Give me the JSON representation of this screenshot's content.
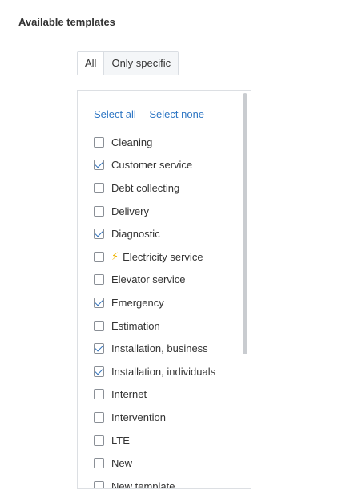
{
  "section": {
    "title": "Available templates"
  },
  "toggle": {
    "all_label": "All",
    "specific_label": "Only specific",
    "selected": "Only specific"
  },
  "actions": {
    "select_all": "Select all",
    "select_none": "Select none"
  },
  "templates": [
    {
      "label": "Cleaning",
      "checked": false
    },
    {
      "label": "Customer service",
      "checked": true
    },
    {
      "label": "Debt collecting",
      "checked": false
    },
    {
      "label": "Delivery",
      "checked": false
    },
    {
      "label": "Diagnostic",
      "checked": true
    },
    {
      "label": "Electricity service",
      "checked": false,
      "icon": "lightning-icon"
    },
    {
      "label": "Elevator service",
      "checked": false
    },
    {
      "label": "Emergency",
      "checked": true
    },
    {
      "label": "Estimation",
      "checked": false
    },
    {
      "label": "Installation, business",
      "checked": true
    },
    {
      "label": "Installation, individuals",
      "checked": true
    },
    {
      "label": "Internet",
      "checked": false
    },
    {
      "label": "Intervention",
      "checked": false
    },
    {
      "label": "LTE",
      "checked": false
    },
    {
      "label": "New",
      "checked": false
    },
    {
      "label": "New template",
      "checked": false
    }
  ],
  "colors": {
    "link": "#2f77c4",
    "checkmark": "#2f6fb8",
    "bolt": "#f0b400"
  }
}
